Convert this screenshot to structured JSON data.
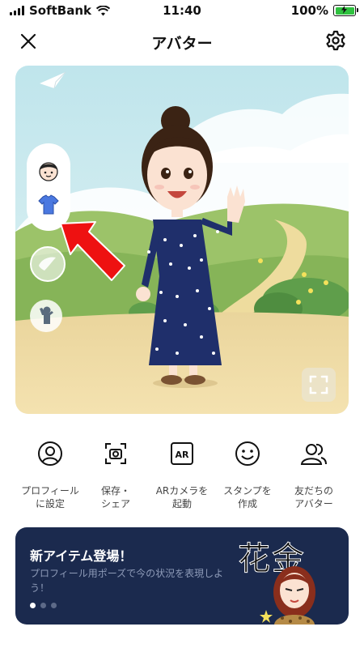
{
  "status_bar": {
    "carrier": "SoftBank",
    "time": "11:40",
    "battery": "100%"
  },
  "header": {
    "title": "アバター"
  },
  "avatar_panel": {
    "side_menu": [
      "face-tab",
      "clothes-tab",
      "background-tab",
      "pose-tab"
    ]
  },
  "actions": [
    {
      "icon": "profile-icon",
      "label": "プロフィール\nに設定"
    },
    {
      "icon": "camera-frame-icon",
      "label": "保存・\nシェア"
    },
    {
      "icon": "ar-icon",
      "label": "ARカメラを\n起動",
      "icon_text": "AR"
    },
    {
      "icon": "smile-icon",
      "label": "スタンプを\n作成"
    },
    {
      "icon": "friends-icon",
      "label": "友だちの\nアバター"
    }
  ],
  "banner": {
    "title": "新アイテム登場！",
    "subtitle": "プロフィール用ポーズで今の状況を表現しよう！",
    "handwriting": "花金",
    "page_count": 3,
    "active_page": 1
  },
  "colors": {
    "banner_bg": "#1b2a4e",
    "arrow": "#ee1111",
    "battery": "#2fc13f"
  }
}
